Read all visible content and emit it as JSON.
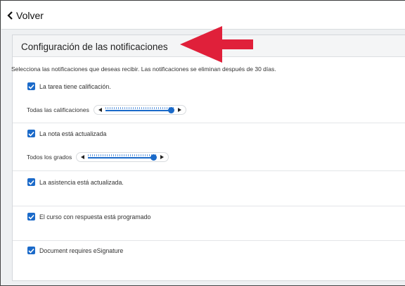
{
  "nav": {
    "back_label": "Volver"
  },
  "panel": {
    "title": "Configuración de las notificaciones",
    "intro": "Selecciona las notificaciones que deseas recibir. Las notificaciones se eliminan después de 30 días."
  },
  "settings": [
    {
      "label": "La tarea tiene calificación.",
      "checked": true,
      "slider": {
        "label": "Todas las calificaciones",
        "level": 1.0
      }
    },
    {
      "label": "La nota está actualizada",
      "checked": true,
      "slider": {
        "label": "Todos los grados",
        "level": 1.0
      }
    },
    {
      "label": "La asistencia está actualizada.",
      "checked": true
    },
    {
      "label": "El curso con respuesta está programado",
      "checked": true
    },
    {
      "label": "Document requires eSignature",
      "checked": true
    }
  ],
  "colors": {
    "accent": "#1b6ac9",
    "callout_arrow": "#e0203a",
    "page_background": "#eef0f2"
  },
  "icons": {
    "back": "chevron-left-icon",
    "check": "checkmark-icon",
    "decrease": "caret-left-icon",
    "increase": "caret-right-icon",
    "callout": "red-arrow-icon"
  }
}
